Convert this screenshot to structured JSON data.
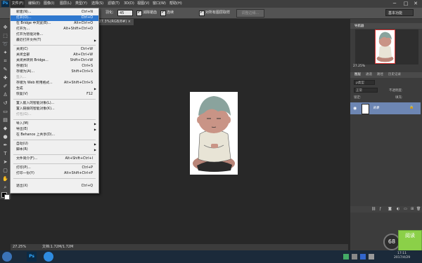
{
  "menubar": {
    "items": [
      "文件(F)",
      "编辑(E)",
      "图像(I)",
      "图层(L)",
      "类型(Y)",
      "选择(S)",
      "滤镜(T)",
      "3D(D)",
      "视图(V)",
      "窗口(W)",
      "帮助(H)"
    ],
    "minimize": "─",
    "maximize": "□",
    "close": "✕"
  },
  "options": {
    "feather_label": "羽化:",
    "feather_value": "45",
    "antialias": "消除锯齿",
    "contiguous": "连续",
    "all_layers": "对所有图层取样",
    "refine": "调整边缘...",
    "workspace": "基本功能"
  },
  "doc_tab": "@ 27.3%(RGB/8#) ×",
  "file_menu": [
    {
      "label": "新建(N)...",
      "shortcut": "Ctrl+N"
    },
    {
      "label": "打开(O)...",
      "shortcut": "Ctrl+O",
      "highlight": true
    },
    {
      "label": "在 Bridge 中浏览(B)...",
      "shortcut": "Alt+Ctrl+O"
    },
    {
      "label": "打开为...",
      "shortcut": "Alt+Shift+Ctrl+O"
    },
    {
      "label": "打开为智能对象..."
    },
    {
      "label": "最近打开文件(T)",
      "sub": true
    },
    {
      "sep": true
    },
    {
      "label": "关闭(C)",
      "shortcut": "Ctrl+W"
    },
    {
      "label": "关闭全部",
      "shortcut": "Alt+Ctrl+W"
    },
    {
      "label": "关闭并转到 Bridge...",
      "shortcut": "Shift+Ctrl+W"
    },
    {
      "label": "存储(S)",
      "shortcut": "Ctrl+S"
    },
    {
      "label": "存储为(A)...",
      "shortcut": "Shift+Ctrl+S"
    },
    {
      "label": "签入...",
      "disabled": true
    },
    {
      "label": "存储为 Web 所用格式...",
      "shortcut": "Alt+Shift+Ctrl+S"
    },
    {
      "label": "生成",
      "sub": true
    },
    {
      "label": "恢复(V)",
      "shortcut": "F12"
    },
    {
      "sep": true
    },
    {
      "label": "置入嵌入的智能对象(L)..."
    },
    {
      "label": "置入链接的智能对象(K)..."
    },
    {
      "label": "打包(G)...",
      "disabled": true
    },
    {
      "sep": true
    },
    {
      "label": "导入(M)",
      "sub": true
    },
    {
      "label": "导出(E)",
      "sub": true
    },
    {
      "label": "在 Behance 上共享(D)..."
    },
    {
      "sep": true
    },
    {
      "label": "自动(U)",
      "sub": true
    },
    {
      "label": "脚本(R)",
      "sub": true
    },
    {
      "sep": true
    },
    {
      "label": "文件简介(F)...",
      "shortcut": "Alt+Shift+Ctrl+I"
    },
    {
      "sep": true
    },
    {
      "label": "打印(P)...",
      "shortcut": "Ctrl+P"
    },
    {
      "label": "打印一份(Y)",
      "shortcut": "Alt+Shift+Ctrl+P"
    },
    {
      "sep": true
    },
    {
      "label": "退出(X)",
      "shortcut": "Ctrl+Q"
    }
  ],
  "navigator": {
    "title": "导航器",
    "zoom": "27.25%"
  },
  "layers": {
    "tabs": [
      "图层",
      "通道",
      "路径",
      "历史记录"
    ],
    "kind": "ρ类型",
    "mode": "正常",
    "opacity_label": "不透明度:",
    "fill_label": "填充:",
    "lock_label": "锁定:",
    "layer_name": "背景"
  },
  "status": {
    "zoom": "27.25%",
    "doc": "文档:1.72M/1.72M"
  },
  "perf_badge": "68",
  "tray": {
    "time": "17:11",
    "date": "2017/4/29"
  },
  "corner_widget": "阅读"
}
